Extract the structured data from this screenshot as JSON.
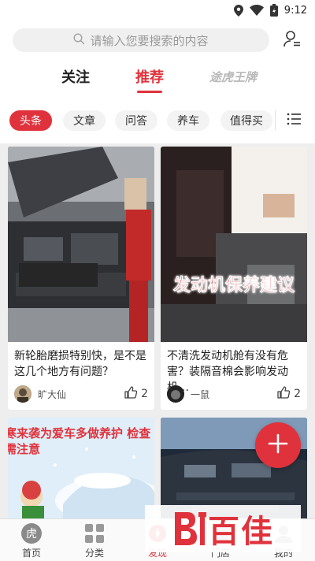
{
  "status_bar": {
    "time": "9:12"
  },
  "search": {
    "placeholder": "请输入您要搜索的内容"
  },
  "top_tabs": [
    {
      "label": "关注"
    },
    {
      "label": "推荐"
    },
    {
      "label": "途虎王牌"
    }
  ],
  "categories": [
    {
      "label": "头条"
    },
    {
      "label": "文章"
    },
    {
      "label": "问答"
    },
    {
      "label": "养车"
    },
    {
      "label": "值得买"
    }
  ],
  "cards": [
    {
      "title": "新轮胎磨损特别快，是不是这几个地方有问题？",
      "author": "旷大仙",
      "likes": "2"
    },
    {
      "title": "不清洗发动机舱有没有危害？装隔音棉会影响发动机…",
      "author": "一鼠",
      "likes": "2",
      "image_caption": "发动机保养建议"
    },
    {
      "image_caption": "寒来袭为爱车多做养护 检查需注意"
    },
    {}
  ],
  "bottom_nav": [
    {
      "label": "首页"
    },
    {
      "label": "分类"
    },
    {
      "label": "发现"
    },
    {
      "label": "门店"
    },
    {
      "label": "我的"
    }
  ],
  "watermark": {
    "text": "百佳"
  },
  "colors": {
    "accent": "#e0323c",
    "background": "#eeeeee"
  }
}
